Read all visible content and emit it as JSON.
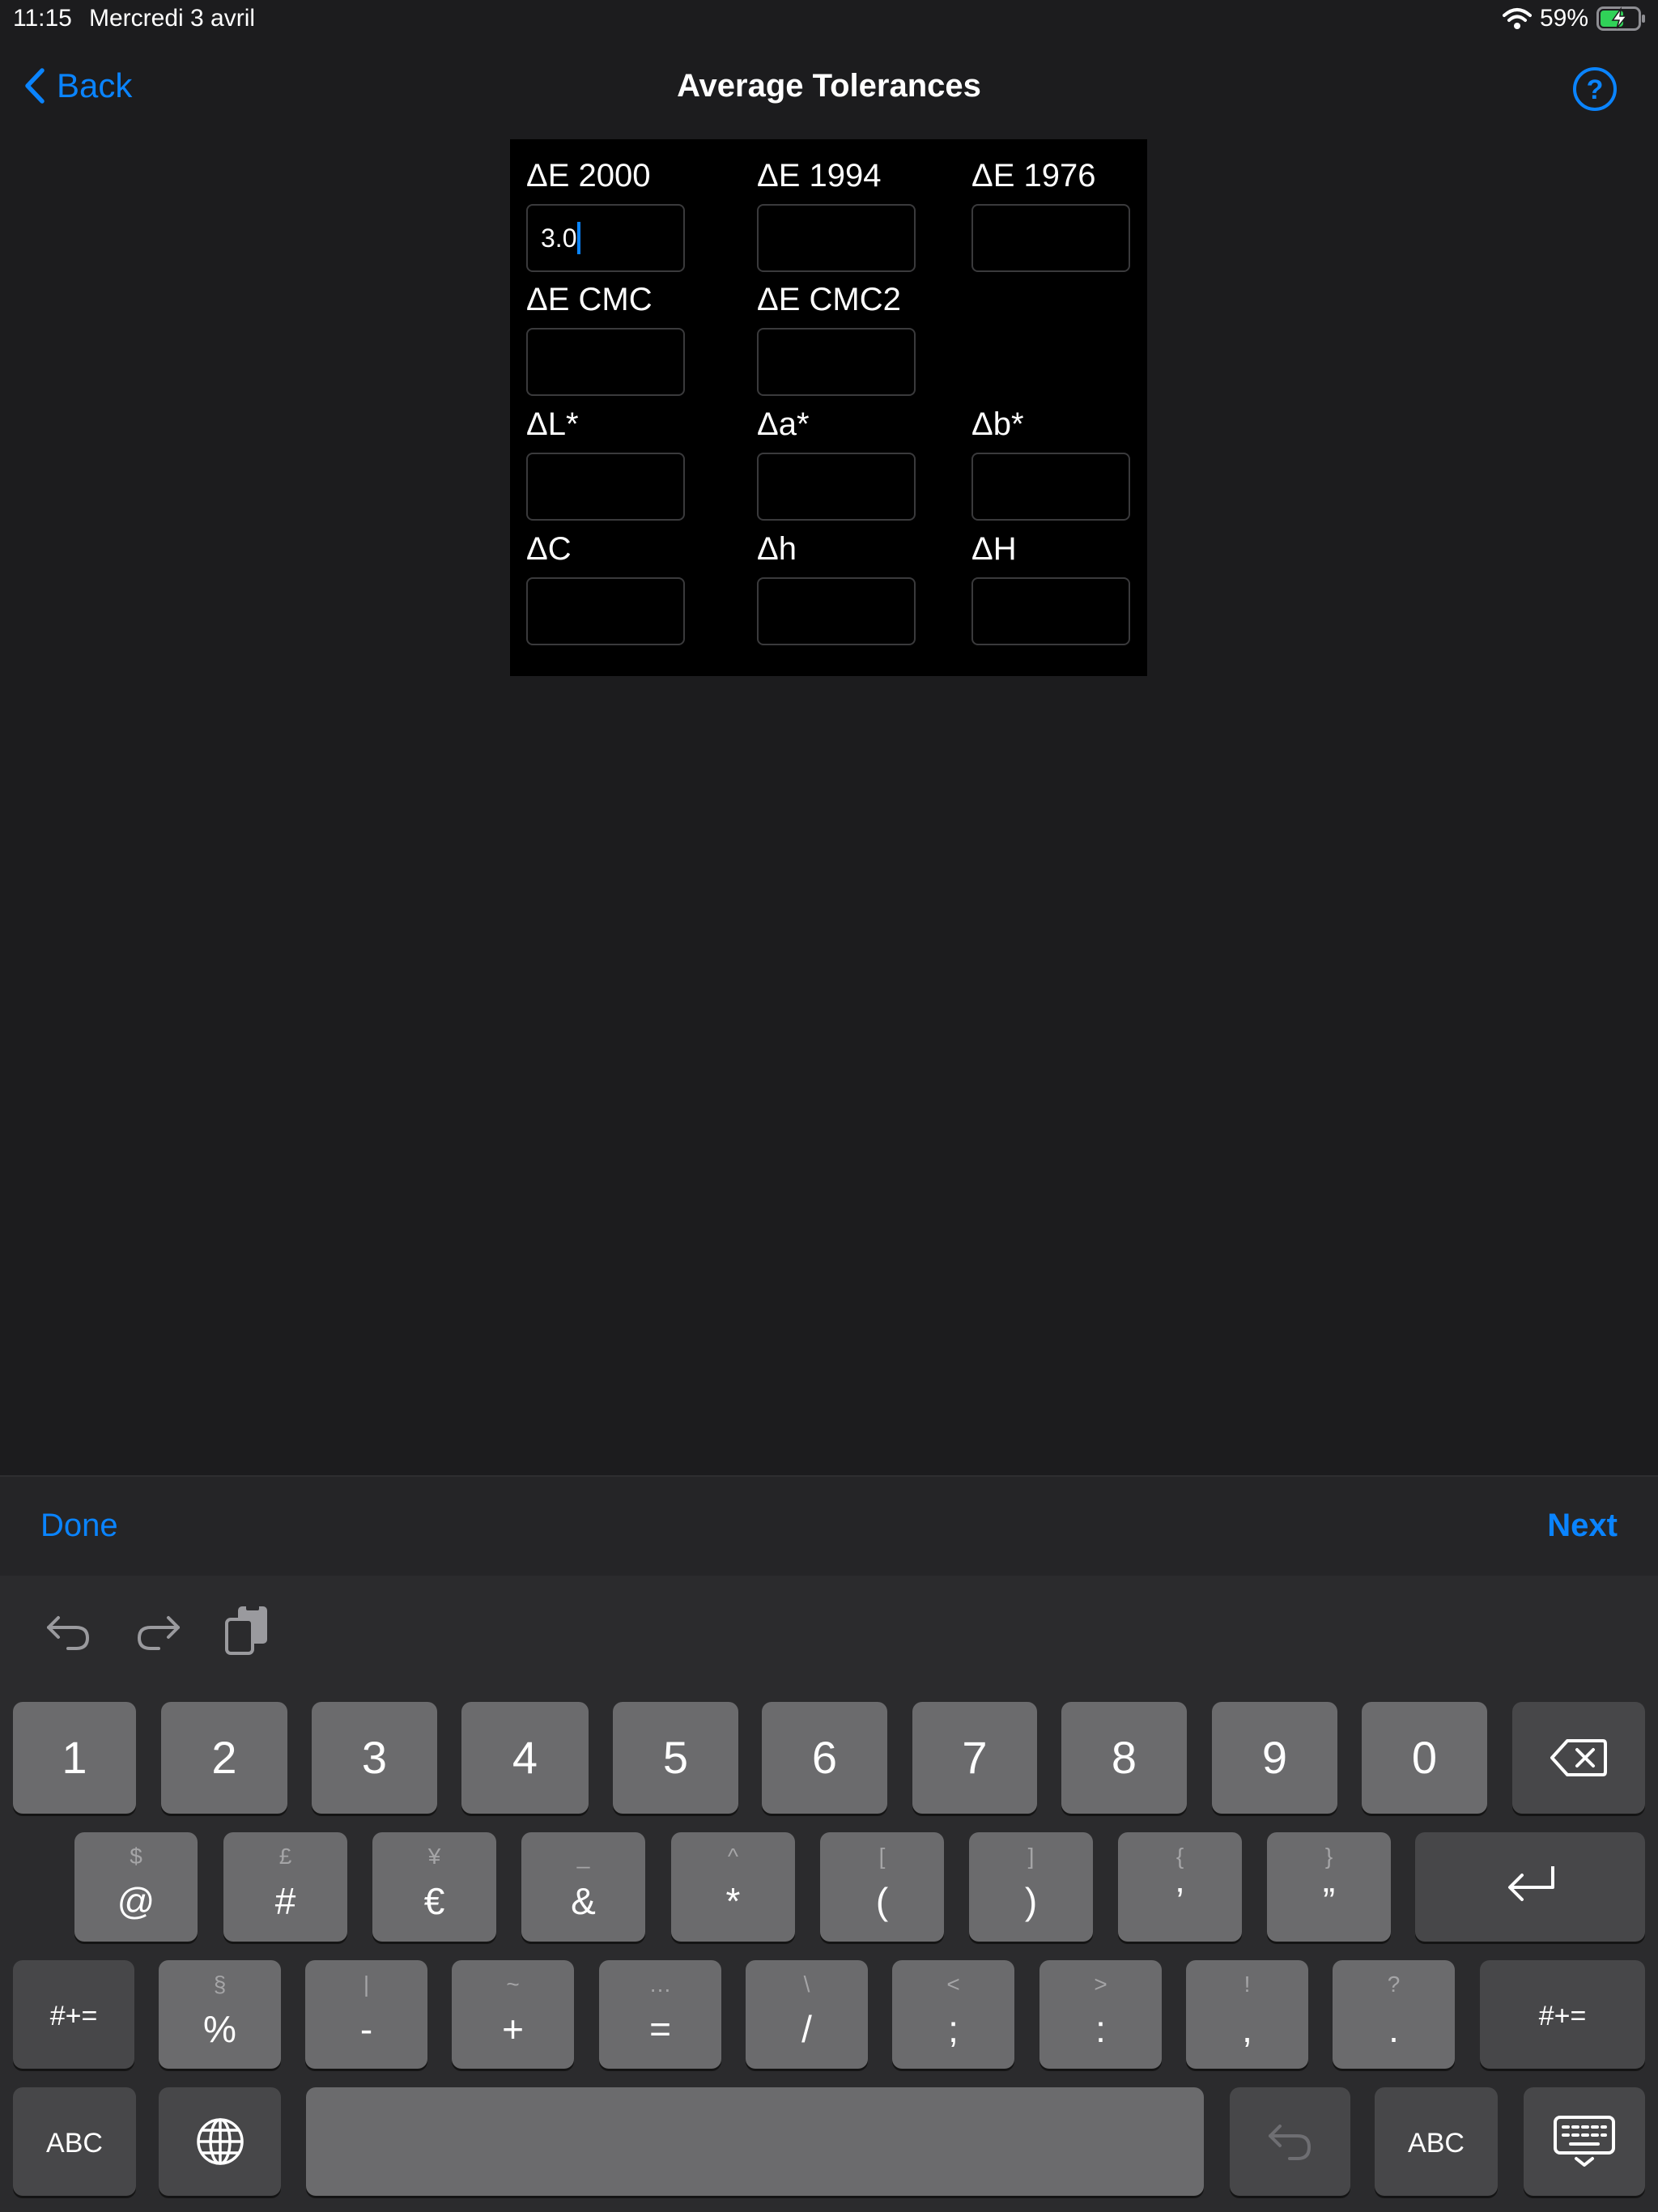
{
  "status": {
    "time": "11:15",
    "date": "Mercredi 3 avril",
    "battery": "59%"
  },
  "nav": {
    "back_label": "Back",
    "title": "Average Tolerances",
    "help_glyph": "?"
  },
  "fields": [
    {
      "label": "ΔE 2000",
      "value": "3.0",
      "focused": true
    },
    {
      "label": "ΔE 1994",
      "value": ""
    },
    {
      "label": "ΔE 1976",
      "value": ""
    },
    {
      "label": "ΔE CMC",
      "value": ""
    },
    {
      "label": "ΔE CMC2",
      "value": ""
    },
    {
      "label": "ΔL*",
      "value": ""
    },
    {
      "label": "Δa*",
      "value": ""
    },
    {
      "label": "Δb*",
      "value": ""
    },
    {
      "label": "ΔC",
      "value": ""
    },
    {
      "label": "Δh",
      "value": ""
    },
    {
      "label": "ΔH",
      "value": ""
    }
  ],
  "accessory": {
    "done_label": "Done",
    "next_label": "Next"
  },
  "keyboard": {
    "row1": [
      "1",
      "2",
      "3",
      "4",
      "5",
      "6",
      "7",
      "8",
      "9",
      "0"
    ],
    "row2": [
      {
        "sub": "$",
        "main": "@"
      },
      {
        "sub": "£",
        "main": "#"
      },
      {
        "sub": "¥",
        "main": "€"
      },
      {
        "sub": "_",
        "main": "&"
      },
      {
        "sub": "^",
        "main": "*"
      },
      {
        "sub": "[",
        "main": "("
      },
      {
        "sub": "]",
        "main": ")"
      },
      {
        "sub": "{",
        "main": "’"
      },
      {
        "sub": "}",
        "main": "”"
      }
    ],
    "row3": [
      {
        "sub": "§",
        "main": "%"
      },
      {
        "sub": "|",
        "main": "-"
      },
      {
        "sub": "~",
        "main": "+"
      },
      {
        "sub": "…",
        "main": "="
      },
      {
        "sub": "\\",
        "main": "/"
      },
      {
        "sub": "<",
        "main": ";"
      },
      {
        "sub": ">",
        "main": ":"
      },
      {
        "sub": "!",
        "main": ","
      },
      {
        "sub": "?",
        "main": "."
      }
    ],
    "symbols_label": "#+=",
    "abc_label": "ABC",
    "icons": [
      "undo-icon",
      "redo-icon",
      "clipboard-icon",
      "backspace-icon",
      "return-icon",
      "globe-icon",
      "keyboard-dismiss-icon"
    ]
  },
  "colors": {
    "accent": "#0a84ff",
    "background": "#1c1c1e",
    "panel": "#000000",
    "key": "#6b6b6d",
    "key_dark": "#474749",
    "battery_fill": "#30d158"
  }
}
